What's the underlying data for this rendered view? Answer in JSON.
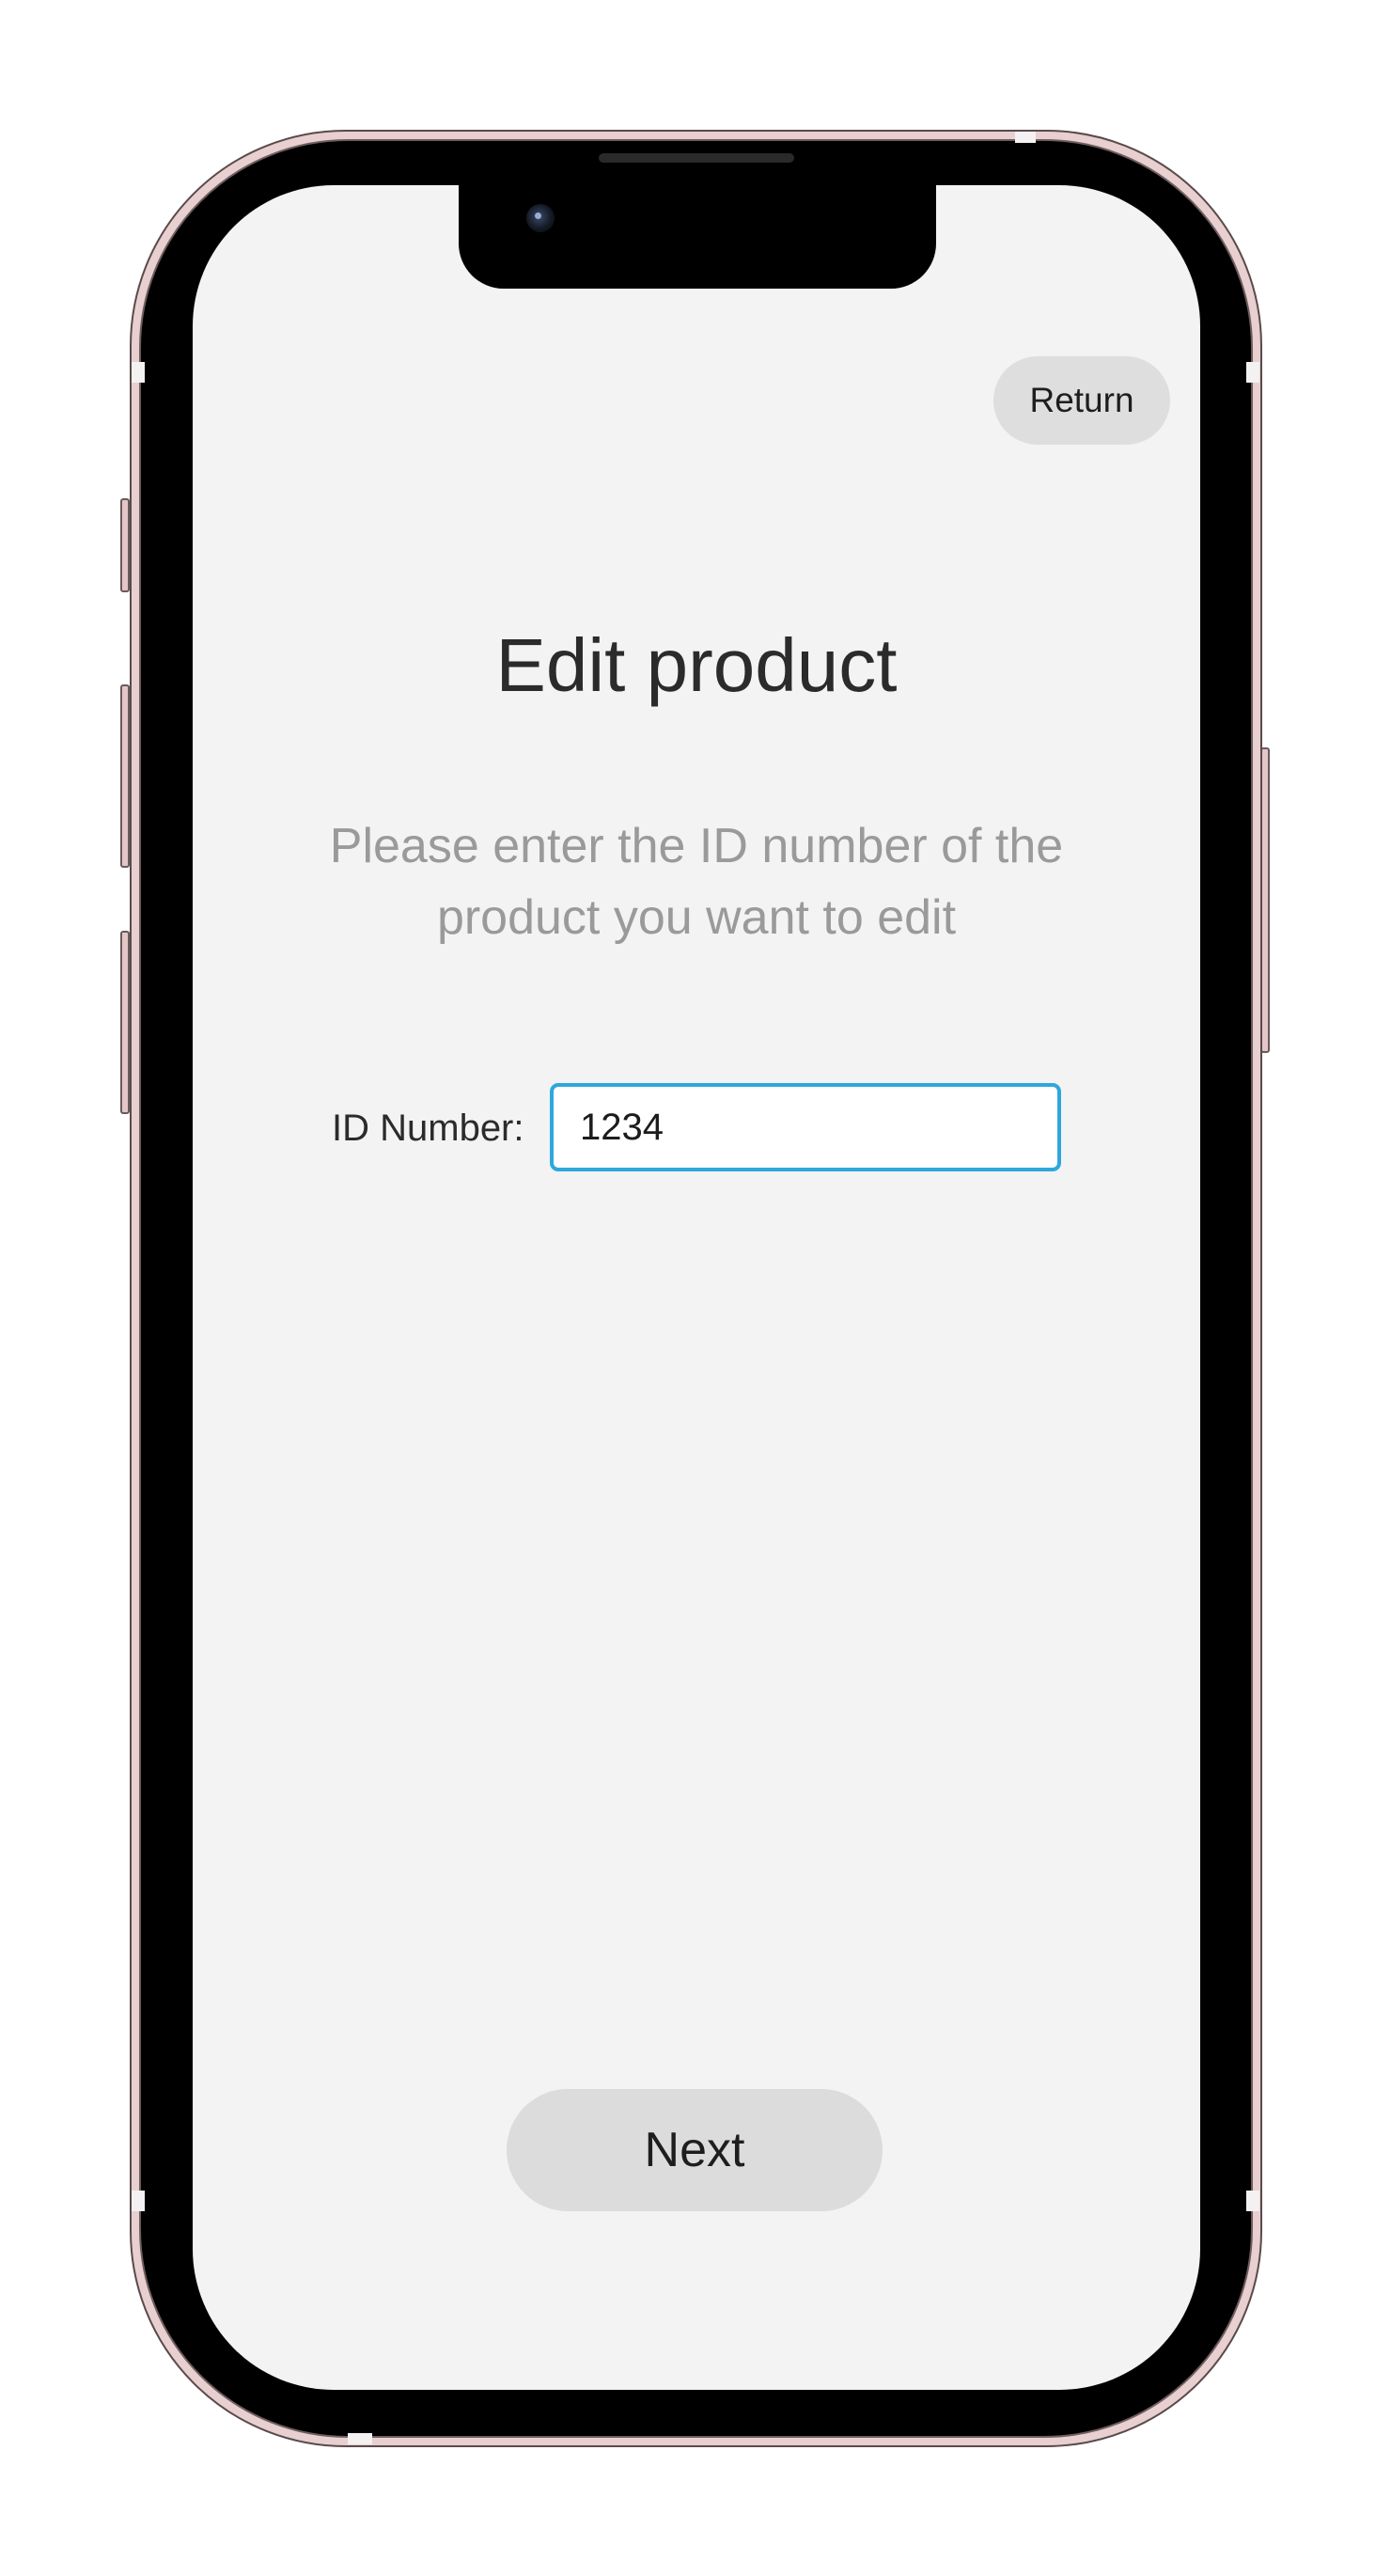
{
  "screen": {
    "return_label": "Return",
    "title": "Edit product",
    "subtitle": "Please enter the ID number of the product you want to edit",
    "id_field": {
      "label": "ID Number:",
      "value": "1234"
    },
    "next_label": "Next"
  },
  "colors": {
    "phone_frame": "#e8cfd0",
    "screen_background": "#f3f3f3",
    "button_background": "#dedede",
    "input_focus_border": "#2fa7dd",
    "subtitle_text": "#9a9a9a",
    "title_text": "#2b2b2b"
  },
  "icons": {
    "camera": "front-camera-icon"
  }
}
